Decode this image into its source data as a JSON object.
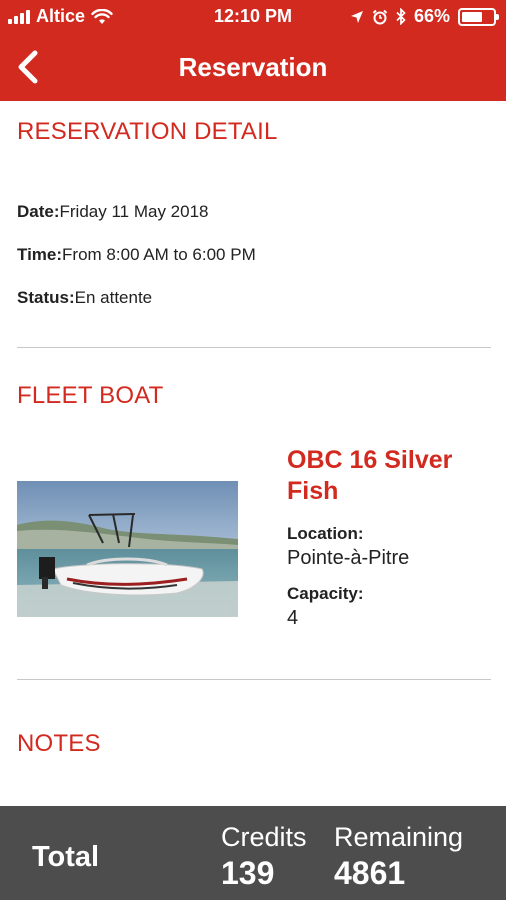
{
  "status_bar": {
    "carrier": "Altice",
    "time": "12:10 PM",
    "battery": "66%",
    "battery_level": 0.66
  },
  "nav": {
    "title": "Reservation",
    "back_icon": "chevron-left-icon"
  },
  "reservation_detail": {
    "heading": "RESERVATION DETAIL",
    "date_label": "Date:",
    "date_value": "Friday 11 May 2018",
    "time_label": "Time:",
    "time_value": "From 8:00 AM to 6:00 PM",
    "status_label": "Status:",
    "status_value": "En attente"
  },
  "fleet_boat": {
    "heading": "FLEET BOAT",
    "name": "OBC 16 Silver Fish",
    "location_label": "Location:",
    "location_value": "Pointe-à-Pitre",
    "capacity_label": "Capacity:",
    "capacity_value": "4"
  },
  "notes": {
    "heading": "NOTES"
  },
  "footer": {
    "total_label": "Total",
    "credits_label": "Credits",
    "credits_value": "139",
    "remaining_label": "Remaining",
    "remaining_value": "4861"
  },
  "colors": {
    "accent": "#d32a20",
    "footer_bg": "#4d4d4d"
  }
}
